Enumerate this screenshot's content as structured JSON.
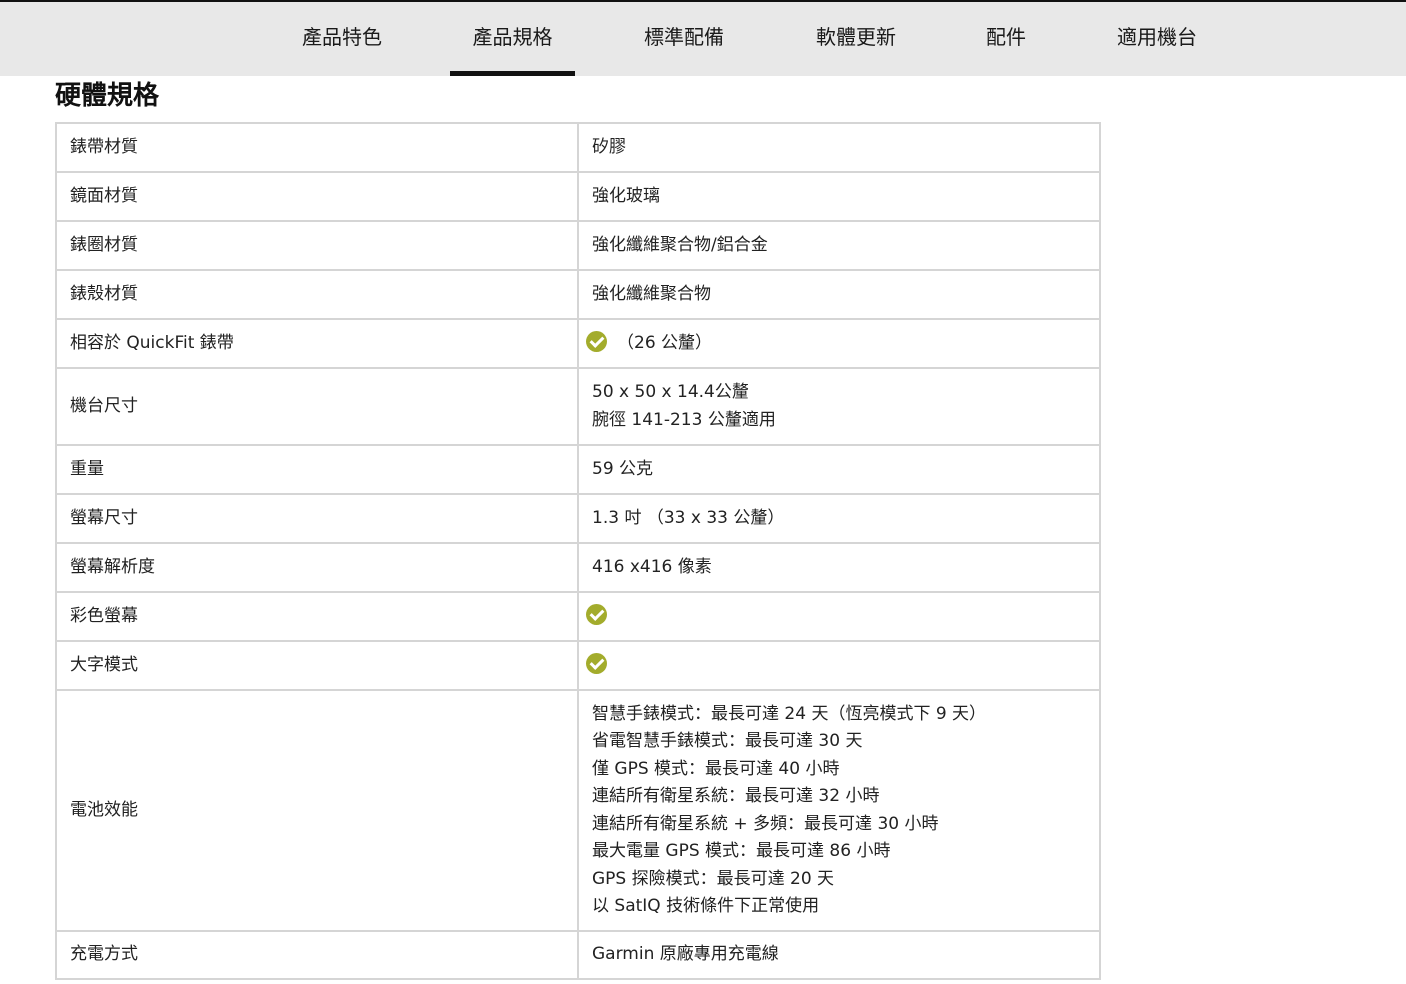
{
  "nav": {
    "tabs": [
      {
        "label": "產品特色",
        "active": false
      },
      {
        "label": "產品規格",
        "active": true
      },
      {
        "label": "標準配備",
        "active": false
      },
      {
        "label": "軟體更新",
        "active": false
      },
      {
        "label": "配件",
        "active": false
      },
      {
        "label": "適用機台",
        "active": false
      }
    ]
  },
  "section": {
    "title": "硬體規格"
  },
  "check_color": "#a3ac2c",
  "specs": [
    {
      "label": "錶帶材質",
      "value": "矽膠"
    },
    {
      "label": "鏡面材質",
      "value": "強化玻璃"
    },
    {
      "label": "錶圈材質",
      "value": "強化纖維聚合物/鋁合金"
    },
    {
      "label": "錶殼材質",
      "value": "強化纖維聚合物"
    },
    {
      "label": "相容於 QuickFit 錶帶",
      "value": "（26 公釐）",
      "check": true
    },
    {
      "label": "機台尺寸",
      "lines": [
        "50 x 50 x 14.4公釐",
        "腕徑 141-213 公釐適用"
      ]
    },
    {
      "label": "重量",
      "value": "59 公克"
    },
    {
      "label": "螢幕尺寸",
      "value": "1.3 吋 （33 x 33 公釐）"
    },
    {
      "label": "螢幕解析度",
      "value": "416 x416 像素"
    },
    {
      "label": "彩色螢幕",
      "value": "",
      "check": true
    },
    {
      "label": "大字模式",
      "value": "",
      "check": true
    },
    {
      "label": "電池效能",
      "lines": [
        "智慧手錶模式：最長可達 24 天（恆亮模式下 9 天）",
        "省電智慧手錶模式：最長可達 30 天",
        "僅 GPS 模式：最長可達 40 小時",
        "連結所有衛星系統：最長可達 32 小時",
        "連結所有衛星系統 + 多頻：最長可達 30 小時",
        "最大電量 GPS 模式：最長可達 86 小時",
        "GPS 探險模式：最長可達 20 天",
        "以 SatIQ 技術條件下正常使用"
      ]
    },
    {
      "label": "充電方式",
      "value": "Garmin 原廠專用充電線"
    }
  ]
}
